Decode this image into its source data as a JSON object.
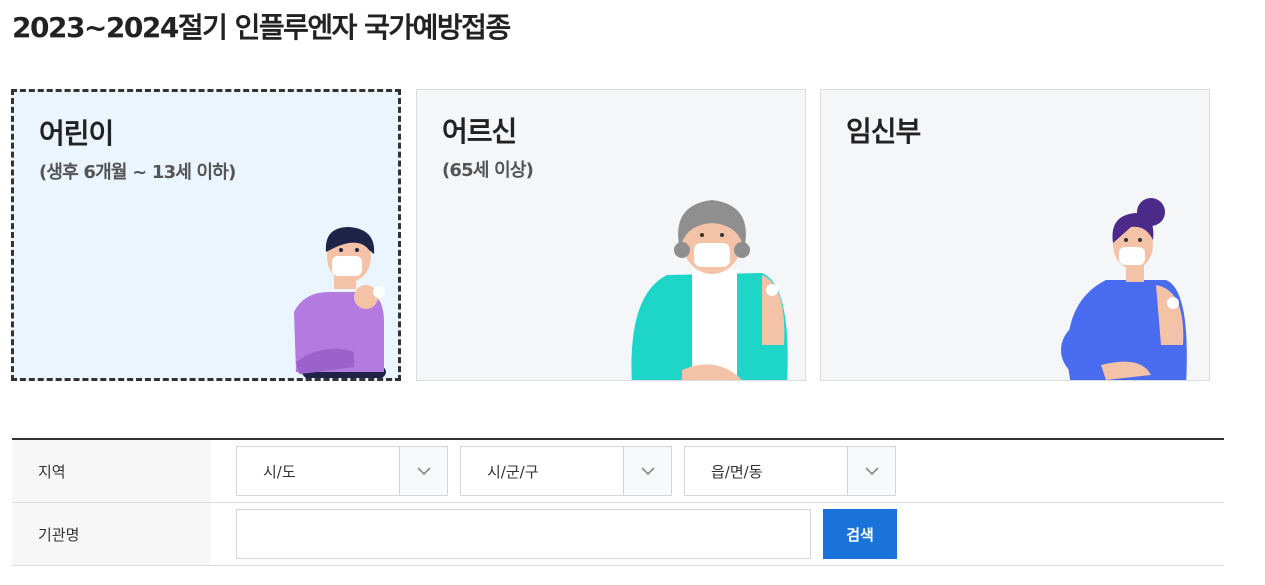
{
  "page": {
    "title": "2023~2024절기 인플루엔자 국가예방접종"
  },
  "cards": [
    {
      "title": "어린이",
      "subtitle": "(생후 6개월 ~ 13세 이하)",
      "selected": true
    },
    {
      "title": "어르신",
      "subtitle": "(65세 이상)",
      "selected": false
    },
    {
      "title": "임신부",
      "subtitle": "",
      "selected": false
    }
  ],
  "search": {
    "region_label": "지역",
    "sido_value": "시/도",
    "sigungu_value": "시/군/구",
    "eupmyeondong_value": "읍/면/동",
    "institution_label": "기관명",
    "institution_value": "",
    "institution_placeholder": "",
    "search_button": "검색"
  },
  "colors": {
    "accent": "#1a73d9",
    "selected_card_bg": "#eaf5ff",
    "card_bg": "#f5f6f8"
  }
}
